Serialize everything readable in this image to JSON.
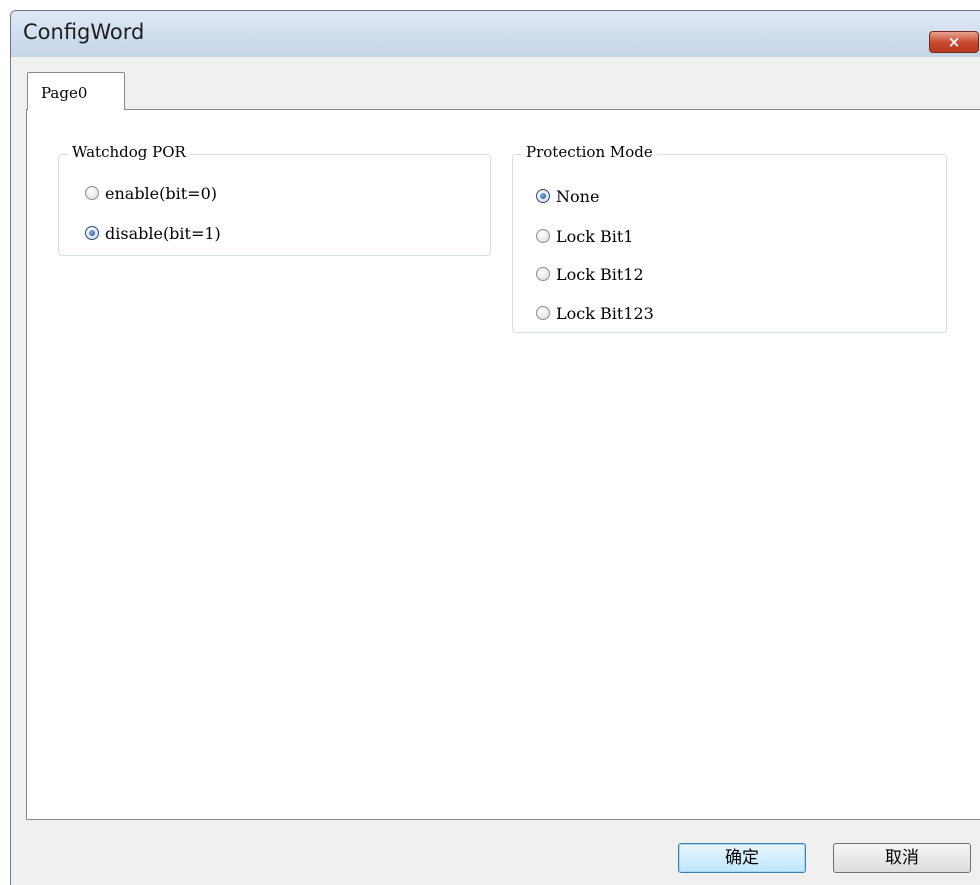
{
  "window": {
    "title": "ConfigWord",
    "close_label": "×"
  },
  "tabs": [
    {
      "label": "Page0",
      "selected": true
    }
  ],
  "groups": {
    "watchdog": {
      "legend": "Watchdog POR",
      "options": [
        {
          "label": "enable(bit=0)",
          "checked": false
        },
        {
          "label": "disable(bit=1)",
          "checked": true
        }
      ]
    },
    "protection": {
      "legend": "Protection Mode",
      "options": [
        {
          "label": "None",
          "checked": true
        },
        {
          "label": "Lock Bit1",
          "checked": false
        },
        {
          "label": "Lock Bit12",
          "checked": false
        },
        {
          "label": "Lock Bit123",
          "checked": false
        }
      ]
    }
  },
  "buttons": {
    "ok_label": "确定",
    "cancel_label": "取消"
  },
  "colors": {
    "titlebar": "#c4d5e8",
    "close_button": "#c8452d",
    "radio_selected": "#1f4d8f",
    "default_button": "#bee6fd"
  }
}
